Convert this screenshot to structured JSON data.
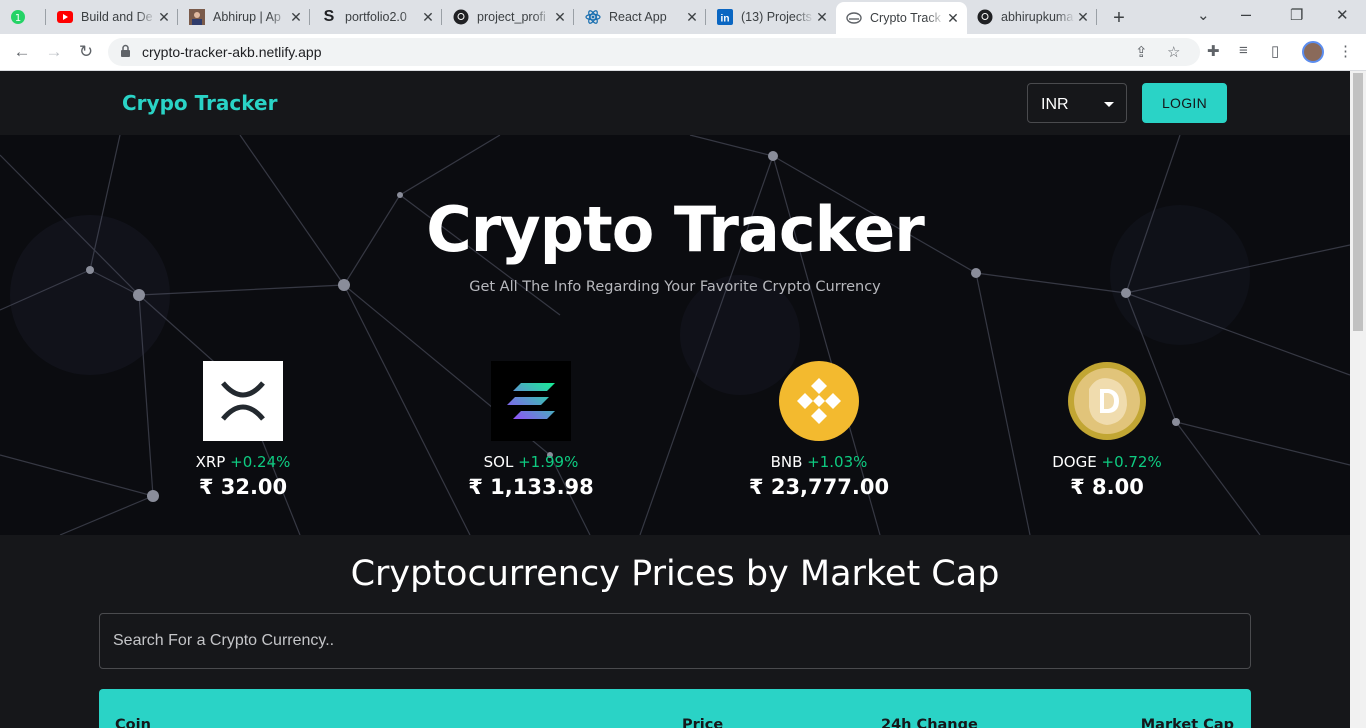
{
  "browser": {
    "tabs": [
      {
        "title": "",
        "icon": "whatsapp-icon",
        "badge": "1"
      },
      {
        "title": "Build and De",
        "icon": "youtube-icon"
      },
      {
        "title": "Abhirup | Ap",
        "icon": "profile-photo-icon"
      },
      {
        "title": "portfolio2.0",
        "icon": "s-logo-icon"
      },
      {
        "title": "project_profi",
        "icon": "github-icon"
      },
      {
        "title": "React App",
        "icon": "react-icon"
      },
      {
        "title": "(13) Projects",
        "icon": "linkedin-icon"
      },
      {
        "title": "Crypto Track",
        "icon": "crypto-tracker-icon",
        "active": true
      },
      {
        "title": "abhirupkuma",
        "icon": "github-icon"
      }
    ],
    "url": "crypto-tracker-akb.netlify.app"
  },
  "app": {
    "brand": "Crypo Tracker",
    "currency": "INR",
    "login_label": "LOGIN",
    "accent": "#2ad3c6"
  },
  "hero": {
    "title": "Crypto Tracker",
    "subtitle": "Get All The Info Regarding Your Favorite Crypto Currency",
    "coins": [
      {
        "symbol": "XRP",
        "change": "+0.24%",
        "price": "₹ 32.00",
        "icon": "xrp-logo"
      },
      {
        "symbol": "SOL",
        "change": "+1.99%",
        "price": "₹ 1,133.98",
        "icon": "solana-logo"
      },
      {
        "symbol": "BNB",
        "change": "+1.03%",
        "price": "₹ 23,777.00",
        "icon": "bnb-logo"
      },
      {
        "symbol": "DOGE",
        "change": "+0.72%",
        "price": "₹ 8.00",
        "icon": "doge-logo"
      }
    ]
  },
  "market": {
    "title": "Cryptocurrency Prices by Market Cap",
    "search_placeholder": "Search For a Crypto Currency..",
    "columns": [
      "Coin",
      "Price",
      "24h Change",
      "Market Cap"
    ]
  }
}
